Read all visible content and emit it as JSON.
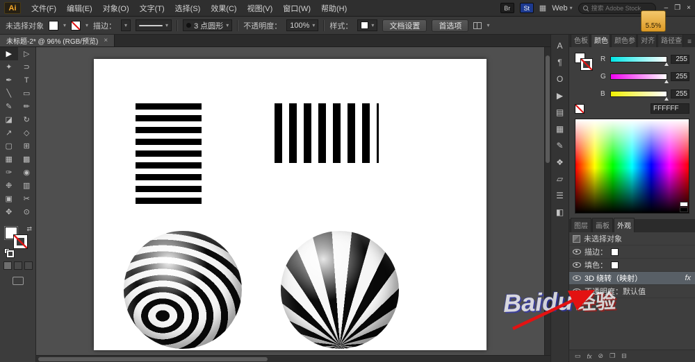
{
  "ui": {
    "dd": "▾",
    "close": "×",
    "hamburger": "≡",
    "swap": "⇄",
    "win_min": "–",
    "win_restore": "❐",
    "win_close": "×"
  },
  "colors": {
    "accent_orange": "#f7a928",
    "annotation_red": "#e31212",
    "canvas_bg": "#4f4f4f",
    "panel_bg": "#3e3e3e",
    "current_color_hex": "#FFFFFF"
  },
  "menubar": {
    "app_logo": "Ai",
    "menus": [
      "文件(F)",
      "编辑(E)",
      "对象(O)",
      "文字(T)",
      "选择(S)",
      "效果(C)",
      "视图(V)",
      "窗口(W)",
      "帮助(H)"
    ],
    "badge_br": "Br",
    "badge_st": "St",
    "arrange_icon": "▦",
    "workspace": "Web",
    "search_placeholder": "搜索 Adobe Stock"
  },
  "options_bar": {
    "no_selection": "未选择对象",
    "stroke_label": "描边：",
    "brush_name": "3 点圆形",
    "opacity_label": "不透明度：",
    "opacity_value": "100%",
    "style_label": "样式：",
    "doc_setup": "文档设置",
    "preferences": "首选项",
    "zoom_tooltip": "5.5%"
  },
  "document_tab": {
    "title": "未标题-2* @ 96% (RGB/预览)"
  },
  "tools": [
    {
      "name": "selection",
      "glyph": "▶"
    },
    {
      "name": "direct-selection",
      "glyph": "▷"
    },
    {
      "name": "magic-wand",
      "glyph": "✦"
    },
    {
      "name": "lasso",
      "glyph": "⊃"
    },
    {
      "name": "pen",
      "glyph": "✒"
    },
    {
      "name": "type",
      "glyph": "T"
    },
    {
      "name": "line-segment",
      "glyph": "╲"
    },
    {
      "name": "rectangle",
      "glyph": "▭"
    },
    {
      "name": "paintbrush",
      "glyph": "✎"
    },
    {
      "name": "pencil",
      "glyph": "✏"
    },
    {
      "name": "eraser",
      "glyph": "◪"
    },
    {
      "name": "rotate",
      "glyph": "↻"
    },
    {
      "name": "scale",
      "glyph": "↗"
    },
    {
      "name": "width",
      "glyph": "◇"
    },
    {
      "name": "free-transform",
      "glyph": "▢"
    },
    {
      "name": "shape-builder",
      "glyph": "⊞"
    },
    {
      "name": "mesh",
      "glyph": "▦"
    },
    {
      "name": "gradient",
      "glyph": "▩"
    },
    {
      "name": "eyedropper",
      "glyph": "✑"
    },
    {
      "name": "blend",
      "glyph": "◉"
    },
    {
      "name": "symbol-sprayer",
      "glyph": "❉"
    },
    {
      "name": "column-graph",
      "glyph": "▥"
    },
    {
      "name": "artboard",
      "glyph": "▣"
    },
    {
      "name": "slice",
      "glyph": "✂"
    },
    {
      "name": "hand",
      "glyph": "✥"
    },
    {
      "name": "zoom",
      "glyph": "⊙"
    }
  ],
  "panel_strip": [
    {
      "name": "character",
      "glyph": "A"
    },
    {
      "name": "paragraph",
      "glyph": "¶"
    },
    {
      "name": "opentype",
      "glyph": "O"
    },
    {
      "name": "actions",
      "glyph": "▶"
    },
    {
      "name": "artboards",
      "glyph": "▤"
    },
    {
      "name": "swatches",
      "glyph": "▦"
    },
    {
      "name": "brushes",
      "glyph": "✎"
    },
    {
      "name": "symbols",
      "glyph": "❖"
    },
    {
      "name": "transform",
      "glyph": "▱"
    },
    {
      "name": "align",
      "glyph": "☰"
    },
    {
      "name": "pathfinder",
      "glyph": "◧"
    }
  ],
  "color_panel": {
    "tabs": [
      "色板",
      "颜色",
      "颜色参",
      "对齐",
      "路径查"
    ],
    "channels": [
      {
        "label": "R",
        "value": "255"
      },
      {
        "label": "G",
        "value": "255"
      },
      {
        "label": "B",
        "value": "255"
      }
    ],
    "hex": "FFFFFF"
  },
  "appearance_panel": {
    "tabs": [
      "图层",
      "画板",
      "外观"
    ],
    "rows": [
      {
        "label": "未选择对象"
      },
      {
        "label": "描边："
      },
      {
        "label": "填色："
      },
      {
        "label": "3D 绕转（映射）",
        "fx": "fx"
      },
      {
        "label": "不透明度：默认值"
      }
    ],
    "footer_icons": [
      {
        "name": "new-stroke",
        "glyph": "▭"
      },
      {
        "name": "new-effect",
        "glyph": "fx"
      },
      {
        "name": "clear-appearance",
        "glyph": "⊘"
      },
      {
        "name": "duplicate-item",
        "glyph": "❐"
      },
      {
        "name": "delete-item",
        "glyph": "⊟"
      }
    ]
  },
  "watermark": {
    "line1": "Baidu",
    "line2": "经验"
  }
}
